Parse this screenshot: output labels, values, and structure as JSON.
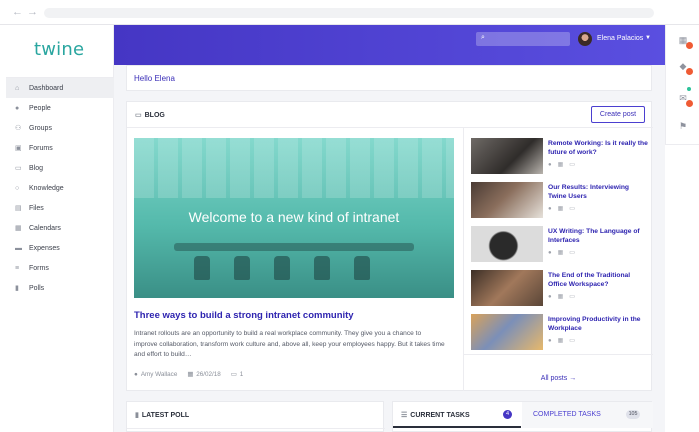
{
  "app": {
    "logo": "twine"
  },
  "sidebar": {
    "items": [
      {
        "label": "Dashboard",
        "icon": "home-icon",
        "active": true
      },
      {
        "label": "People",
        "icon": "person-icon"
      },
      {
        "label": "Groups",
        "icon": "group-icon"
      },
      {
        "label": "Forums",
        "icon": "forum-icon"
      },
      {
        "label": "Blog",
        "icon": "blog-icon"
      },
      {
        "label": "Knowledge",
        "icon": "lightbulb-icon"
      },
      {
        "label": "Files",
        "icon": "file-icon"
      },
      {
        "label": "Calendars",
        "icon": "calendar-icon"
      },
      {
        "label": "Expenses",
        "icon": "expenses-icon"
      },
      {
        "label": "Forms",
        "icon": "forms-icon"
      },
      {
        "label": "Polls",
        "icon": "poll-icon"
      }
    ]
  },
  "header": {
    "user_name": "Elena Palacios"
  },
  "greeting": "Hello Elena",
  "blog": {
    "heading": "BLOG",
    "create_label": "Create post",
    "hero_text": "Welcome to a new kind of intranet",
    "featured": {
      "title": "Three ways to build a strong intranet community",
      "excerpt": "Intranet rollouts are an opportunity to build a real workplace community. They give you a chance to improve collaboration, transform work culture and, above all, keep your employees happy. But it takes time and effort to build…",
      "author": "Amy Wallace",
      "date": "26/02/18",
      "comments": "1"
    },
    "posts": [
      {
        "title": "Remote Working: Is it really the future of work?"
      },
      {
        "title": "Our Results: Interviewing Twine Users"
      },
      {
        "title": "UX Writing: The Language of Interfaces"
      },
      {
        "title": "The End of the Traditional Office Workspace?"
      },
      {
        "title": "Improving Productivity in the Workplace"
      }
    ],
    "all_posts_label": "All posts →"
  },
  "poll": {
    "heading": "LATEST POLL"
  },
  "tasks": {
    "current_label": "CURRENT TASKS",
    "current_count": "4",
    "completed_label": "COMPLETED TASKS",
    "completed_count": "105"
  },
  "colors": {
    "brand_purple": "#4536c4",
    "link_purple": "#2e24b0",
    "logo_teal": "#2aa6a0",
    "alert_orange": "#ef5b34",
    "online_green": "#2cc39a"
  }
}
